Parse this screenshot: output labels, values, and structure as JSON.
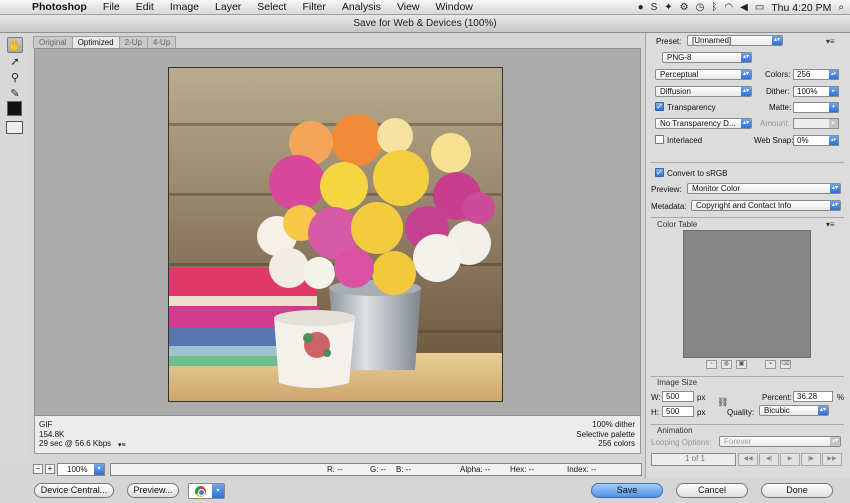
{
  "menubar": {
    "apple": "",
    "app_name": "Photoshop",
    "menus": [
      "File",
      "Edit",
      "Image",
      "Layer",
      "Select",
      "Filter",
      "Analysis",
      "View",
      "Window"
    ],
    "clock": "Thu 4:20 PM",
    "status_icons": [
      "evernote-icon",
      "skype-icon",
      "dropbox-icon",
      "settings-icon",
      "time-machine-icon",
      "bluetooth-icon",
      "wifi-icon",
      "volume-icon",
      "battery-icon",
      "search-icon"
    ]
  },
  "dialog": {
    "title": "Save for Web & Devices (100%)"
  },
  "tabs": [
    "Original",
    "Optimized",
    "2-Up",
    "4-Up"
  ],
  "active_tab": "Optimized",
  "info": {
    "format": "GIF",
    "size": "154.8K",
    "download": "29 sec @ 56.6 Kbps",
    "dither": "100% dither",
    "palette": "Selective palette",
    "colors": "256 colors",
    "menu_glyph": "▾≡"
  },
  "zoom": {
    "minus": "−",
    "plus": "+",
    "value": "100%"
  },
  "readout": {
    "r": "R: --",
    "g": "G: --",
    "b": "B: --",
    "alpha": "Alpha: --",
    "hex": "Hex: --",
    "index": "Index: --"
  },
  "buttons": {
    "device_central": "Device Central...",
    "preview": "Preview...",
    "save": "Save",
    "cancel": "Cancel",
    "done": "Done"
  },
  "settings": {
    "preset_label": "Preset:",
    "preset_value": "[Unnamed]",
    "format_value": "PNG-8",
    "reduction_value": "Perceptual",
    "colors_label": "Colors:",
    "colors_value": "256",
    "dither_algo_value": "Diffusion",
    "dither_label": "Dither:",
    "dither_value": "100%",
    "transparency_label": "Transparency",
    "transparency_checked": true,
    "matte_label": "Matte:",
    "matte_value": "",
    "transparency_dither_value": "No Transparency D...",
    "amount_label": "Amount:",
    "amount_value": "",
    "interlaced_label": "Interlaced",
    "interlaced_checked": false,
    "websnap_label": "Web Snap:",
    "websnap_value": "0%",
    "convert_label": "Convert to sRGB",
    "convert_checked": true,
    "preview_label": "Preview:",
    "preview_value": "Monitor Color",
    "metadata_label": "Metadata:",
    "metadata_value": "Copyright and Contact Info",
    "panel_menu_glyph": "▾≡"
  },
  "color_table": {
    "title": "Color Table",
    "icons": [
      "map-color-icon",
      "web-shift-icon",
      "lock-color-icon",
      "new-color-icon",
      "delete-color-icon"
    ]
  },
  "image_size": {
    "title": "Image Size",
    "w_label": "W:",
    "w_value": "500",
    "h_label": "H:",
    "h_value": "500",
    "unit": "px",
    "percent_label": "Percent:",
    "percent_value": "36.28",
    "percent_unit": "%",
    "quality_label": "Quality:",
    "quality_value": "Bicubic"
  },
  "animation": {
    "title": "Animation",
    "looping_label": "Looping Options:",
    "looping_value": "Forever",
    "frame_counter": "1 of 1"
  },
  "colors": {
    "accent_blue": "#2c71d8",
    "canvas_gray": "#ababab",
    "panel_gray": "#dcdcdc"
  }
}
